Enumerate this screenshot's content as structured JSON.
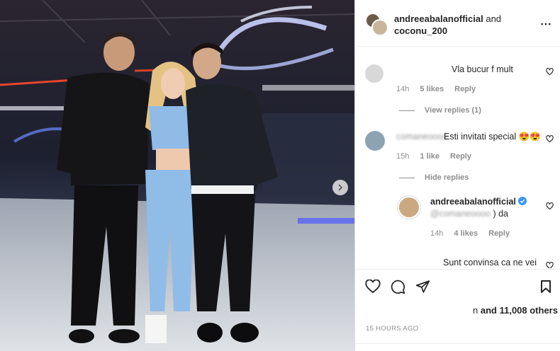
{
  "header": {
    "username_primary": "andreeabalanofficial",
    "connector": "and",
    "username_secondary": "coconu_200",
    "more_icon": "⋯"
  },
  "comments": [
    {
      "text": "Vla bucur f mult",
      "time": "14h",
      "likes": "5 likes",
      "reply": "Reply",
      "view_replies": "View replies (1)"
    },
    {
      "text": "Esti invitati special",
      "emoji": "😍😍",
      "time": "15h",
      "likes": "1 like",
      "reply": "Reply",
      "hide_replies": "Hide replies"
    },
    {
      "username": "andreeabalanofficial",
      "verified": true,
      "text": ") da",
      "time": "14h",
      "likes": "4 likes",
      "reply": "Reply"
    },
    {
      "text": "Sunt convinsa ca ne vei"
    }
  ],
  "footer": {
    "likes_prefix": "n",
    "likes_text": "and 11,008 others",
    "timestamp": "15 HOURS AGO"
  },
  "icons": {
    "like": "heart-icon",
    "comment": "comment-icon",
    "share": "share-icon",
    "save": "bookmark-icon",
    "next": "chevron-right-icon"
  },
  "colors": {
    "verified": "#3897f0",
    "text": "#262626",
    "muted": "#8e8e8e"
  }
}
